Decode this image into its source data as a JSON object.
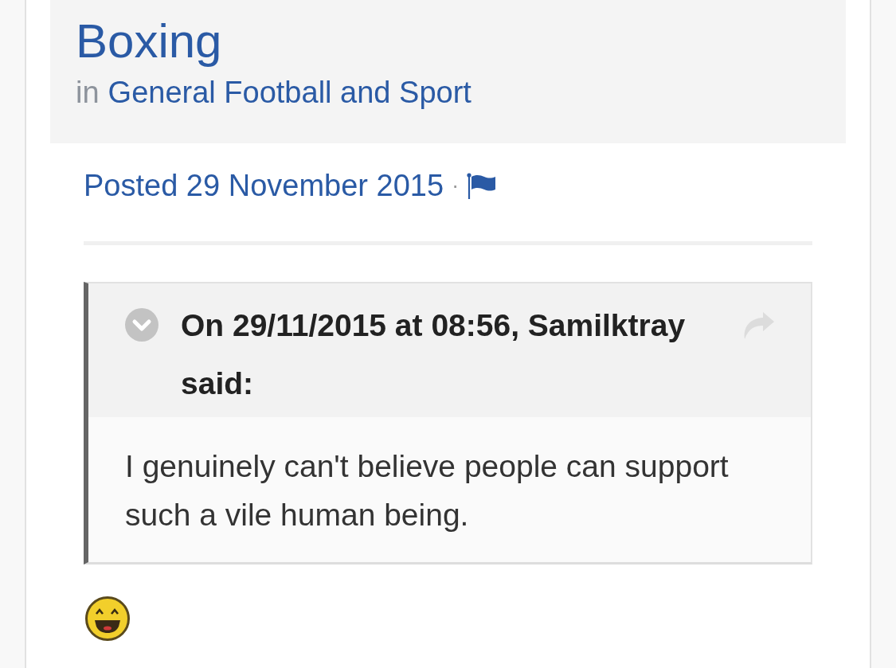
{
  "topic": {
    "title": "Boxing",
    "prefix": "in",
    "forum": "General Football and Sport"
  },
  "post": {
    "posted": "Posted 29 November 2015",
    "separator": "·",
    "quote": {
      "citation": "On 29/11/2015 at 08:56, Samilktray said:",
      "text": "I genuinely can't believe people can support such a vile human being."
    }
  }
}
